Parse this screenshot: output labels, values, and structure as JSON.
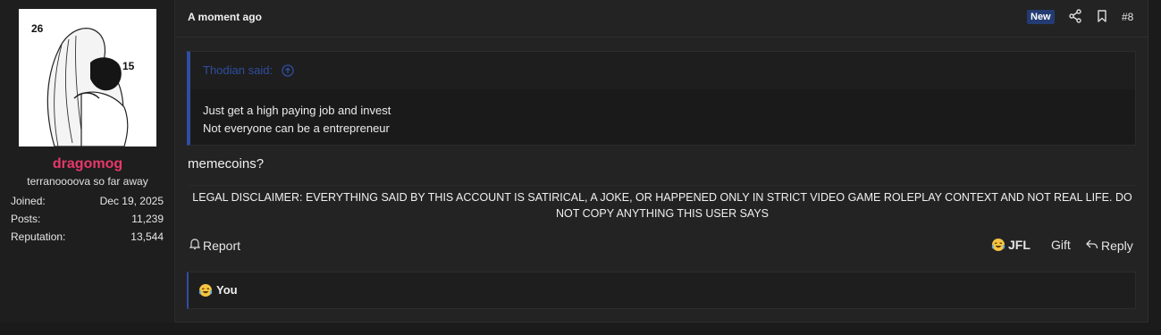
{
  "user": {
    "avatar_labels": [
      "26",
      "15"
    ],
    "name": "dragomog",
    "title": "terranoooova so far away",
    "stats": [
      {
        "label": "Joined:",
        "value": "Dec 19, 2025"
      },
      {
        "label": "Posts:",
        "value": "11,239"
      },
      {
        "label": "Reputation:",
        "value": "13,544"
      }
    ]
  },
  "post": {
    "time": "A moment ago",
    "badge": "New",
    "number": "#8",
    "quote": {
      "author": "Thodian said:",
      "lines": [
        "Just get a high paying job and invest",
        "Not everyone can be a entrepreneur"
      ]
    },
    "message": "memecoins?",
    "signature": "LEGAL DISCLAIMER: EVERYTHING SAID BY THIS ACCOUNT IS SATIRICAL, A JOKE, OR HAPPENED ONLY IN STRICT VIDEO GAME ROLEPLAY CONTEXT AND NOT REAL LIFE. DO NOT COPY ANYTHING THIS USER SAYS",
    "actions": {
      "report": "Report",
      "react": "JFL",
      "gift": "Gift",
      "reply": "Reply"
    },
    "reactions_text": "You"
  },
  "icons": [
    "share-icon",
    "bookmark-icon",
    "arrow-up-circle-icon",
    "bell-icon",
    "crying-laughing-emoji-icon",
    "reply-arrow-icon"
  ],
  "colors": {
    "username": "#e8386a",
    "accent": "#2f4ea0",
    "badge": "#233b72"
  }
}
